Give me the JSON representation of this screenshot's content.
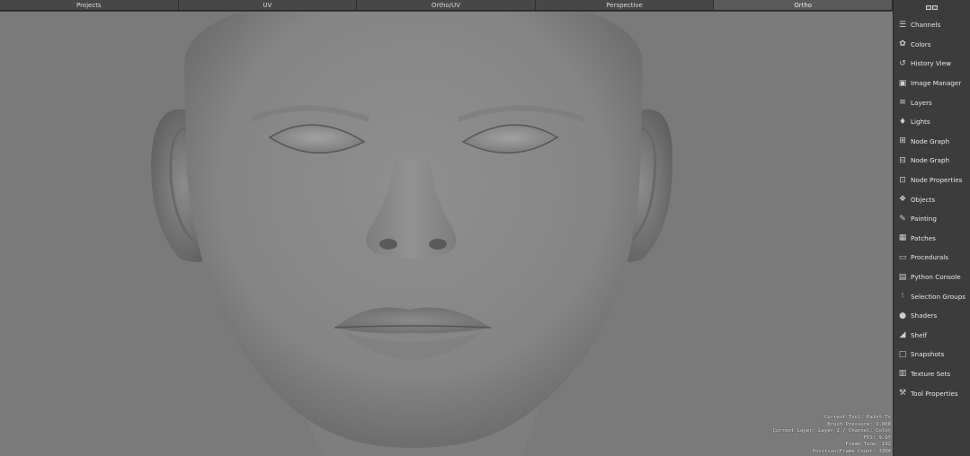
{
  "tabs": [
    {
      "label": "Projects",
      "active": false
    },
    {
      "label": "UV",
      "active": false
    },
    {
      "label": "Ortho/UV",
      "active": false
    },
    {
      "label": "Perspective",
      "active": false
    },
    {
      "label": "Ortho",
      "active": true
    }
  ],
  "panel": {
    "items": [
      {
        "label": "Channels",
        "icon": "channels-icon"
      },
      {
        "label": "Colors",
        "icon": "colors-icon"
      },
      {
        "label": "History View",
        "icon": "history-icon"
      },
      {
        "label": "Image Manager",
        "icon": "image-manager-icon"
      },
      {
        "label": "Layers",
        "icon": "layers-icon"
      },
      {
        "label": "Lights",
        "icon": "lightbulb-icon"
      },
      {
        "label": "Node Graph",
        "icon": "node-icon"
      },
      {
        "label": "Node Graph",
        "icon": "node-graph-icon"
      },
      {
        "label": "Node Properties",
        "icon": "node-properties-icon"
      },
      {
        "label": "Objects",
        "icon": "objects-icon"
      },
      {
        "label": "Painting",
        "icon": "painting-icon"
      },
      {
        "label": "Patches",
        "icon": "patches-icon"
      },
      {
        "label": "Procedurals",
        "icon": "procedurals-icon"
      },
      {
        "label": "Python Console",
        "icon": "python-console-icon"
      },
      {
        "label": "Selection Groups",
        "icon": "selection-groups-icon"
      },
      {
        "label": "Shaders",
        "icon": "shaders-icon"
      },
      {
        "label": "Shelf",
        "icon": "shelf-icon"
      },
      {
        "label": "Snapshots",
        "icon": "snapshots-icon"
      },
      {
        "label": "Texture Sets",
        "icon": "texture-sets-icon"
      },
      {
        "label": "Tool Properties",
        "icon": "tool-properties-icon"
      }
    ]
  },
  "hud": {
    "lines": [
      "Current Tool: Paint Tx",
      "Brush Pressure: 1.000",
      "Current Layer: Layer 1 / Channel: Color",
      "FPS: 9.97",
      "Frame Time: 192",
      "Position/Frame Count: 3394"
    ]
  },
  "colors": {
    "viewport_bg": "#7a7a7a",
    "panel_bg": "#3c3c3c",
    "tab_bg": "#474747",
    "model_gray": "#8b8b8b"
  }
}
